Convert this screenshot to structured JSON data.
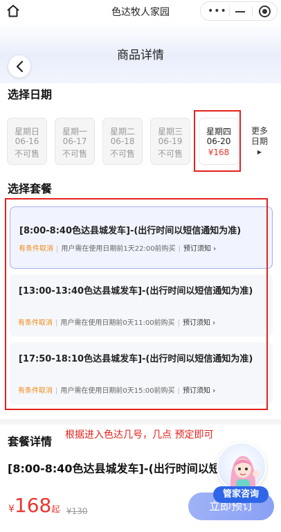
{
  "app": {
    "title": "色达牧人家园",
    "capsule_more": "•••"
  },
  "header": {
    "title": "商品详情"
  },
  "dates": {
    "section_title": "选择日期",
    "items": [
      {
        "weekday": "星期日",
        "date": "06-16",
        "status": "不可售"
      },
      {
        "weekday": "星期一",
        "date": "06-17",
        "status": "不可售"
      },
      {
        "weekday": "星期二",
        "date": "06-18",
        "status": "不可售"
      },
      {
        "weekday": "星期三",
        "date": "06-19",
        "status": "不可售"
      },
      {
        "weekday": "星期四",
        "date": "06-20",
        "status": "¥168",
        "selected": true
      }
    ],
    "more_label_1": "更多",
    "more_label_2": "日期",
    "more_arrow": "▶"
  },
  "packages": {
    "section_title": "选择套餐",
    "items": [
      {
        "title": "[8:00-8:40色达县城发车]-(出行时间以短信通知为准)",
        "condition": "有条件取消",
        "rule": "用户需在使用日期前1天22:00前购买",
        "notice": "预订须知 ›",
        "selected": true
      },
      {
        "title": "[13:00-13:40色达县城发车]-(出行时间以短信通知为准)",
        "condition": "有条件取消",
        "rule": "用户需在使用日期前0天11:00前购买",
        "notice": "预订须知 ›"
      },
      {
        "title": "[17:50-18:10色达县城发车]-(出行时间以短信通知为准)",
        "condition": "有条件取消",
        "rule": "用户需在使用日期前0天15:00前购买",
        "notice": "预订须知 ›"
      }
    ]
  },
  "details": {
    "section_title": "套餐详情",
    "annotation": "根据进入色达几号，几点  预定即可",
    "subtitle": "[8:00-8:40色达县城发车]-(出行时间以短信通知为准)"
  },
  "bottom": {
    "currency": "¥",
    "price": "168",
    "price_suffix": "起",
    "original_price": "¥130",
    "book_label": "立即预订",
    "butler_label": "管家咨询"
  },
  "colors": {
    "accent_red": "#e8352f",
    "highlight_frame": "#e3211c",
    "primary_blue": "#2f66e8",
    "condition_orange": "#f08a17"
  }
}
